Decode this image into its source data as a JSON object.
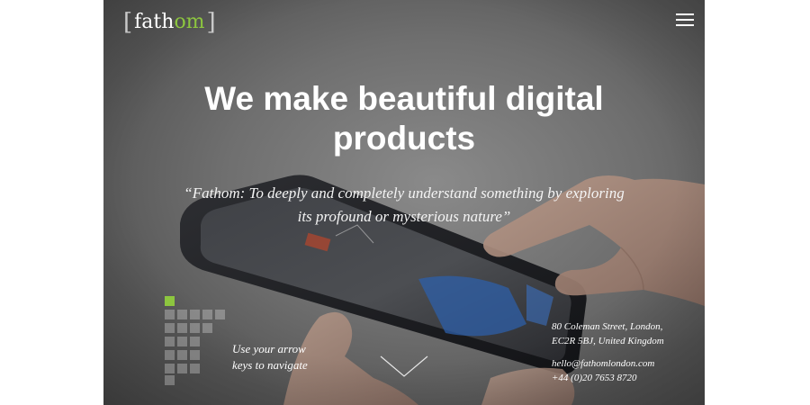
{
  "logo": {
    "left_bracket": "[",
    "text_main": "fath",
    "text_accent": "om",
    "right_bracket": "]"
  },
  "menu": {
    "icon": "hamburger-icon"
  },
  "hero": {
    "headline_line1": "We make beautiful digital",
    "headline_line2": "products",
    "quote_line1": "“Fathom: To deeply and completely understand something by exploring",
    "quote_line2": "its profound or mysterious nature”"
  },
  "navigation": {
    "hint_line1": "Use your arrow",
    "hint_line2": "keys to navigate",
    "scroll_icon": "chevron-down-icon"
  },
  "footer": {
    "address_line1": "80 Coleman Street, London,",
    "address_line2": "EC2R 5BJ, United Kingdom",
    "email": "hello@fathomlondon.com",
    "phone": "+44 (0)20 7653 8720"
  },
  "colors": {
    "accent": "#8dc63f",
    "text": "#ffffff"
  }
}
